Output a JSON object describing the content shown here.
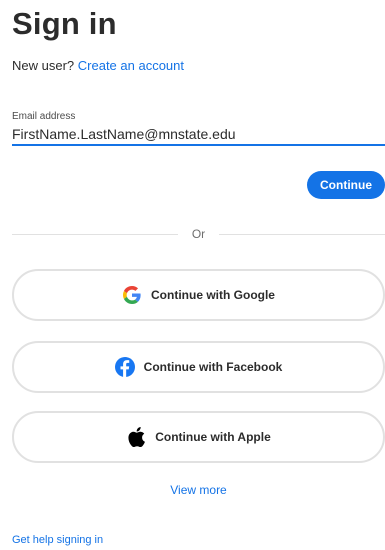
{
  "header": {
    "title": "Sign in",
    "new_user_prompt": "New user?",
    "create_account_link": "Create an account"
  },
  "email": {
    "label": "Email address",
    "value": "FirstName.LastName@mnstate.edu"
  },
  "continue_label": "Continue",
  "divider_text": "Or",
  "social": {
    "google_label": "Continue with Google",
    "facebook_label": "Continue with Facebook",
    "apple_label": "Continue with Apple"
  },
  "view_more_label": "View more",
  "help_link": "Get help signing in",
  "icons": {
    "google": "google-icon",
    "facebook": "facebook-icon",
    "apple": "apple-icon"
  },
  "colors": {
    "accent": "#1473e6",
    "text": "#2c2c2c",
    "border": "#e1e1e1",
    "facebook": "#1877f2"
  }
}
